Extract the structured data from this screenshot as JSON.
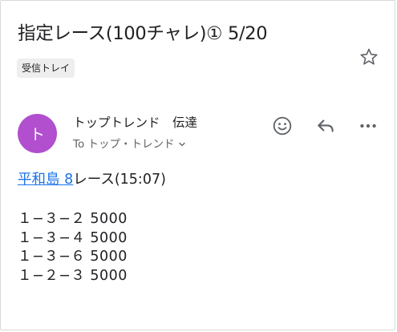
{
  "email": {
    "subject": "指定レース(100チャレ)①  5/20",
    "label_chip": "受信トレイ",
    "sender": {
      "avatar_letter": "ト",
      "avatar_color": "#b14fce",
      "name": "トップトレンド　伝達",
      "recipient_line": "To トップ・トレンド"
    },
    "body": {
      "venue_link": "平和島 8",
      "race_text": "レース(15:07)",
      "bets": [
        "１−３−２ 5000",
        "１−３−４ 5000",
        "１−３−６ 5000",
        "１−２−３ 5000"
      ]
    }
  },
  "icons": {
    "star": "star-icon",
    "emoji": "emoji-reaction-icon",
    "reply": "reply-icon",
    "more": "more-options-icon",
    "chevron": "chevron-down-icon"
  },
  "colors": {
    "link": "#1a73e8",
    "text": "#202124",
    "secondary": "#5f6368",
    "chip_bg": "#eeeeee"
  }
}
